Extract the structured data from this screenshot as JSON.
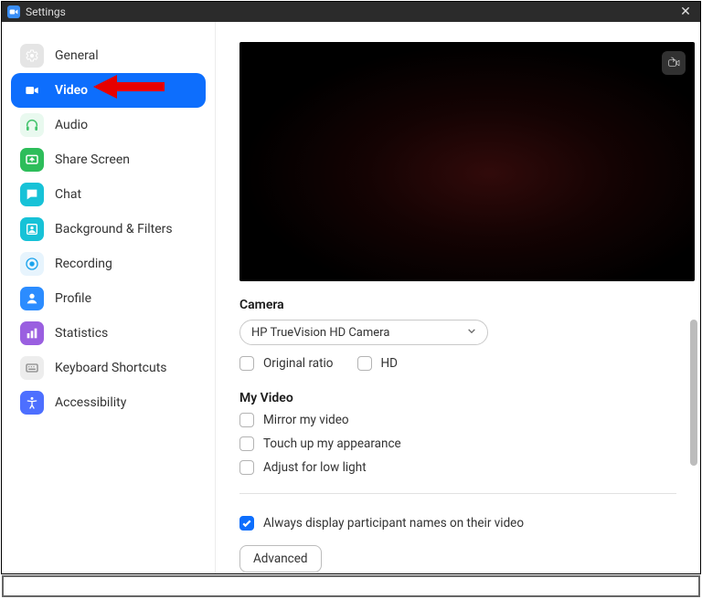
{
  "title": "Settings",
  "sidebar": {
    "items": [
      {
        "label": "General",
        "icon": "gear-icon",
        "color": "#cfcfcf",
        "active": false
      },
      {
        "label": "Video",
        "icon": "video-icon",
        "color": "#ffffff",
        "active": true
      },
      {
        "label": "Audio",
        "icon": "headphones-icon",
        "color": "#41c36b",
        "active": false
      },
      {
        "label": "Share Screen",
        "icon": "share-screen-icon",
        "color": "#2dbd5a",
        "active": false
      },
      {
        "label": "Chat",
        "icon": "chat-icon",
        "color": "#17c2d7",
        "active": false
      },
      {
        "label": "Background & Filters",
        "icon": "background-icon",
        "color": "#17c2d7",
        "active": false
      },
      {
        "label": "Recording",
        "icon": "recording-icon",
        "color": "#1aa3ec",
        "active": false
      },
      {
        "label": "Profile",
        "icon": "profile-icon",
        "color": "#2b8cff",
        "active": false
      },
      {
        "label": "Statistics",
        "icon": "statistics-icon",
        "color": "#9a5fe0",
        "active": false
      },
      {
        "label": "Keyboard Shortcuts",
        "icon": "keyboard-icon",
        "color": "#8a8a8a",
        "active": false
      },
      {
        "label": "Accessibility",
        "icon": "accessibility-icon",
        "color": "#4d6fff",
        "active": false
      }
    ]
  },
  "camera": {
    "section_label": "Camera",
    "selected": "HP TrueVision HD Camera",
    "original_ratio": {
      "label": "Original ratio",
      "checked": false
    },
    "hd": {
      "label": "HD",
      "checked": false
    }
  },
  "my_video": {
    "section_label": "My Video",
    "mirror": {
      "label": "Mirror my video",
      "checked": false
    },
    "touch_up": {
      "label": "Touch up my appearance",
      "checked": false
    },
    "low_light": {
      "label": "Adjust for low light",
      "checked": false
    }
  },
  "always_display_names": {
    "label": "Always display participant names on their video",
    "checked": true
  },
  "advanced_label": "Advanced",
  "annotation": {
    "type": "red-arrow",
    "points_to": "sidebar-item-video"
  }
}
